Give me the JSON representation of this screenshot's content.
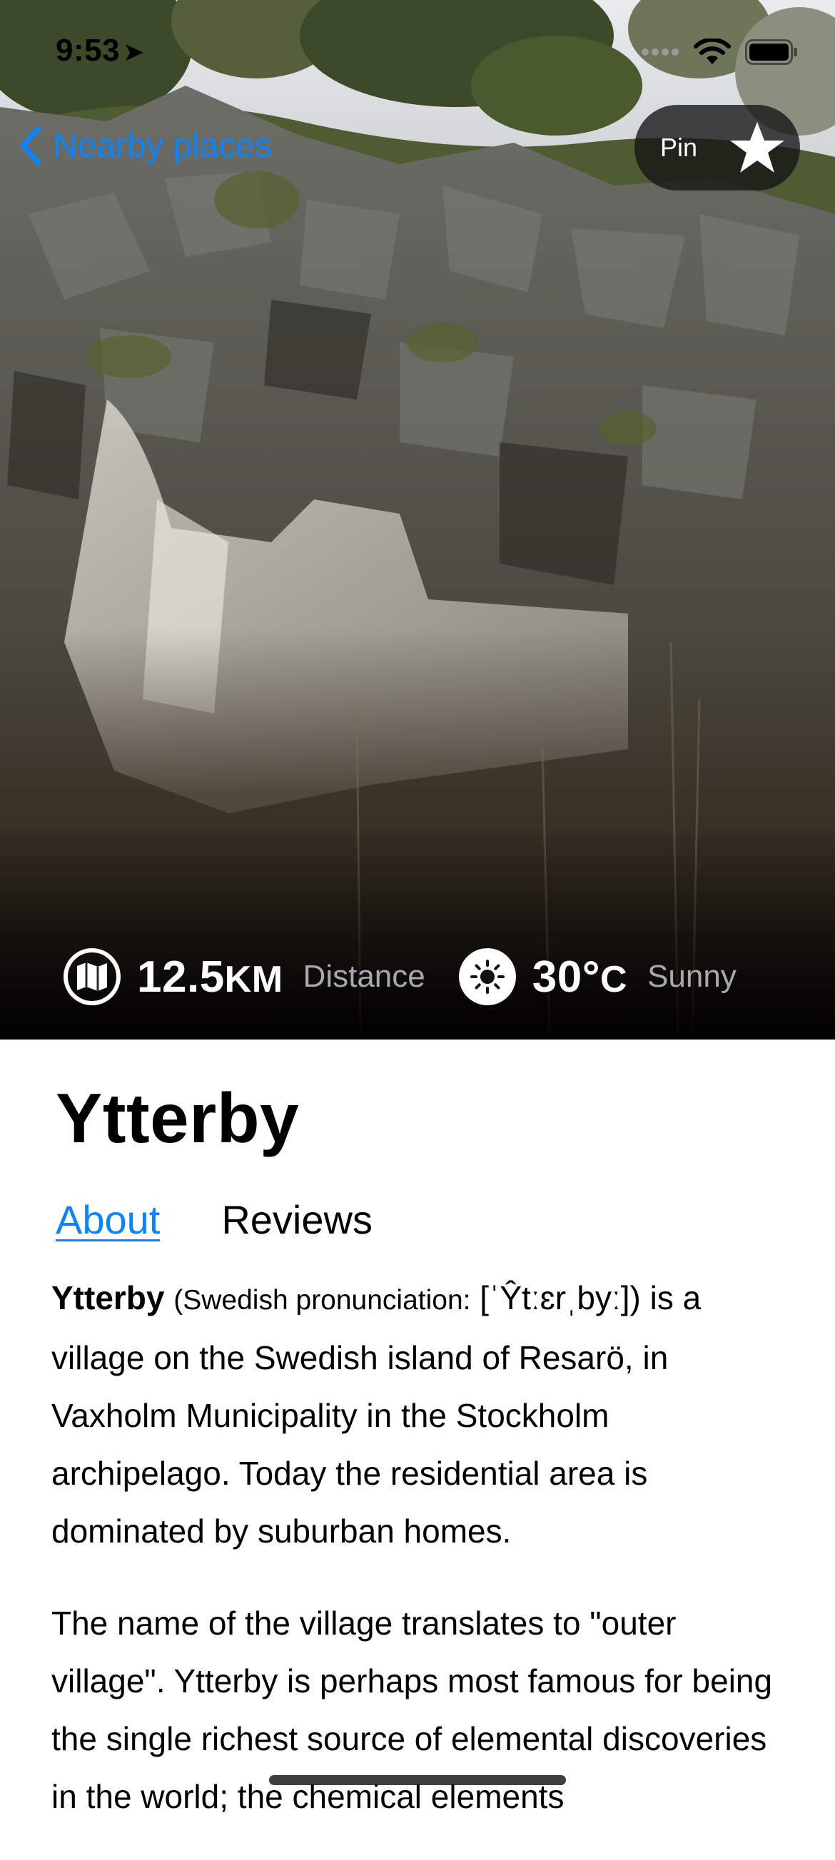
{
  "status_bar": {
    "time": "9:53",
    "location_icon": "location-arrow-icon",
    "signal_icon": "cellular-signal-icon",
    "wifi_icon": "wifi-icon",
    "battery_icon": "battery-icon"
  },
  "nav": {
    "back_label": "Nearby places",
    "back_icon": "chevron-left-icon"
  },
  "pin_button": {
    "label": "Pin",
    "icon": "star-icon"
  },
  "stats": {
    "distance": {
      "value": "12.5",
      "unit": "KM",
      "caption": "Distance",
      "icon": "map-icon"
    },
    "weather": {
      "value": "30°",
      "unit": "C",
      "caption": "Sunny",
      "icon": "sun-icon"
    }
  },
  "place": {
    "title": "Ytterby"
  },
  "tabs": [
    {
      "label": "About",
      "selected": true
    },
    {
      "label": "Reviews",
      "selected": false
    }
  ],
  "article": {
    "lead_name": "Ytterby",
    "pronunciation": "(Swedish pronunciation:",
    "ipa": "[ˈŶtːɛrˌbyː])",
    "p1_rest": "is a village on the Swedish island of Resarö, in Vaxholm Municipality in the Stockholm archipelago. Today the residential area is dominated by suburban homes.",
    "p2": "The name of the village translates to \"outer village\". Ytterby is perhaps most famous for being the single richest source of elemental discoveries in the world; the chemical elements"
  },
  "colors": {
    "accent": "#0a84ff",
    "pin_background": "#141414"
  }
}
